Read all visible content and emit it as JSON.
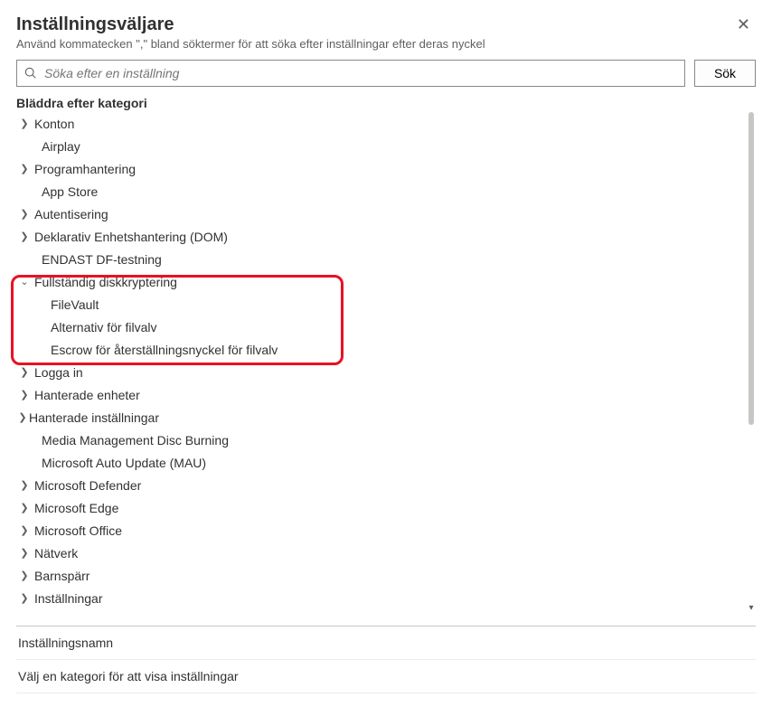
{
  "header": {
    "title": "Inställningsväljare",
    "subtitle": "Använd kommatecken \",\" bland söktermer för att söka efter inställningar efter deras nyckel"
  },
  "search": {
    "placeholder": "Söka efter en inställning",
    "button": "Sök"
  },
  "browse_label": "Bläddra efter kategori",
  "tree": [
    {
      "label": "Konton",
      "chev": "right"
    },
    {
      "label": "Airplay",
      "chev": "none"
    },
    {
      "label": "Programhantering",
      "chev": "right"
    },
    {
      "label": "App Store",
      "chev": "none"
    },
    {
      "label": "Autentisering",
      "chev": "right"
    },
    {
      "label": "Deklarativ Enhetshantering (DOM)",
      "chev": "right"
    },
    {
      "label": "ENDAST DF-testning",
      "chev": "none"
    },
    {
      "label": "Fullständig diskkryptering",
      "chev": "down",
      "children": [
        {
          "label": "FileVault"
        },
        {
          "label": "Alternativ för filvalv"
        },
        {
          "label": "Escrow för återställningsnyckel för filvalv"
        }
      ]
    },
    {
      "label": "Logga in",
      "chev": "right"
    },
    {
      "label": "Hanterade enheter",
      "chev": "right"
    },
    {
      "label": "Hanterade inställningar",
      "chev": "right_tight"
    },
    {
      "label": "Media Management Disc Burning",
      "chev": "none"
    },
    {
      "label": "Microsoft Auto Update (MAU)",
      "chev": "none"
    },
    {
      "label": "Microsoft Defender",
      "chev": "right"
    },
    {
      "label": "Microsoft Edge",
      "chev": "right"
    },
    {
      "label": "Microsoft Office",
      "chev": "right"
    },
    {
      "label": "Nätverk",
      "chev": "right"
    },
    {
      "label": "Barnspärr",
      "chev": "right"
    },
    {
      "label": "Inställningar",
      "chev": "right"
    }
  ],
  "bottom": {
    "col_header": "Inställningsnamn",
    "empty_msg": "Välj en kategori för att visa inställningar"
  }
}
